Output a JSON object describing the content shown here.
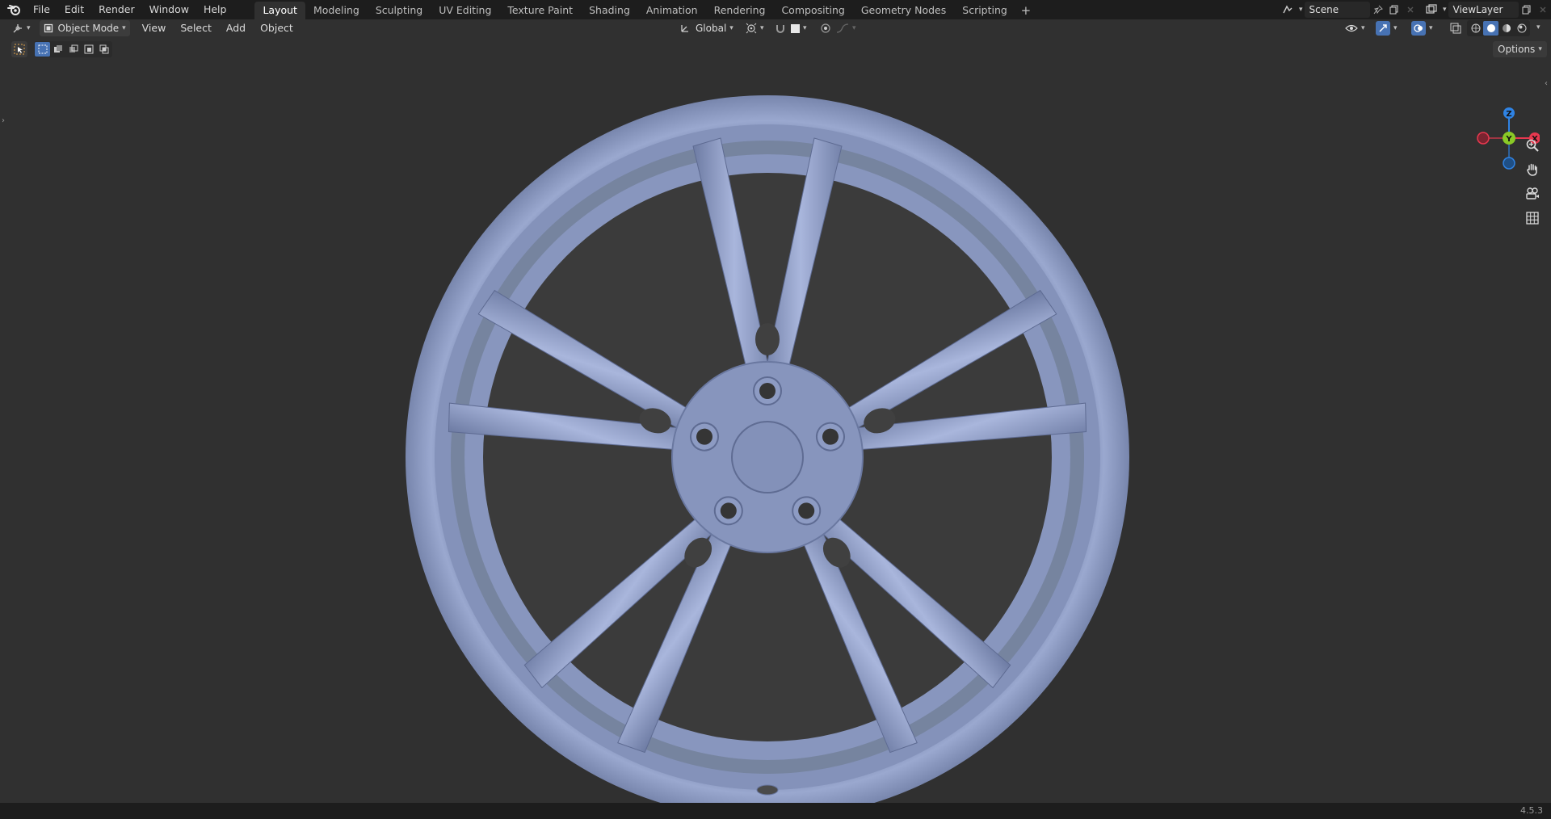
{
  "app": {
    "menu": [
      "File",
      "Edit",
      "Render",
      "Window",
      "Help"
    ],
    "workspaces": [
      "Layout",
      "Modeling",
      "Sculpting",
      "UV Editing",
      "Texture Paint",
      "Shading",
      "Animation",
      "Rendering",
      "Compositing",
      "Geometry Nodes",
      "Scripting"
    ],
    "active_workspace": "Layout",
    "add_workspace": "+",
    "scene": "Scene",
    "view_layer": "ViewLayer",
    "version": "4.5.3"
  },
  "viewport_header": {
    "mode": "Object Mode",
    "menus": [
      "View",
      "Select",
      "Add",
      "Object"
    ],
    "transform_orientation": "Global",
    "options_label": "Options"
  },
  "gizmo": {
    "x_label": "X",
    "y_label": "Y",
    "z_label": "Z",
    "colors": {
      "x": "#e8384f",
      "y": "#8ac926",
      "z": "#2f83e4"
    }
  },
  "colors": {
    "accent": "#4772b3",
    "wheel": "#8c9bc4",
    "background": "#303030"
  },
  "icons": {
    "logo": "blender-logo-icon",
    "zoom": "zoom-icon",
    "pan": "hand-icon",
    "camera": "camera-icon",
    "grid": "grid-icon"
  }
}
